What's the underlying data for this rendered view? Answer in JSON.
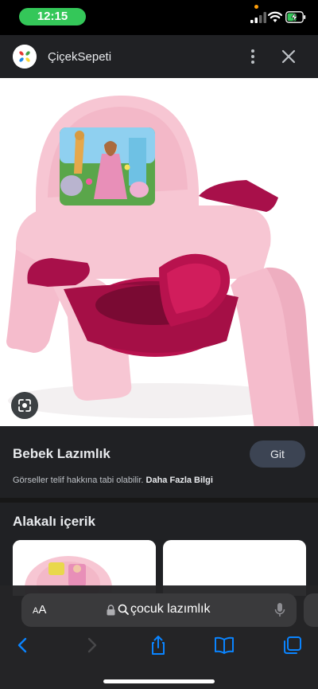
{
  "status_bar": {
    "time": "12:15",
    "time_pill_color": "#34c759",
    "icons": [
      "signal-icon",
      "wifi-icon",
      "battery-charging-icon"
    ]
  },
  "header": {
    "site_name": "ÇiçekSepeti",
    "icons": [
      "ciceksepeti-logo",
      "more-vert-icon",
      "close-icon"
    ]
  },
  "image": {
    "lens_icon": "google-lens-icon"
  },
  "product": {
    "title": "Bebek Lazımlık",
    "go_label": "Git",
    "copyright_text": "Görseller telif hakkına tabi olabilir.",
    "more_info_link": "Daha Fazla Bilgi"
  },
  "related": {
    "title": "Alakalı içerik"
  },
  "browser": {
    "text_size_label_small": "A",
    "text_size_label_large": "A",
    "url_text": "çocuk lazımlık",
    "toolbar_icons": [
      "back-icon",
      "forward-icon",
      "share-icon",
      "bookmarks-icon",
      "tabs-icon"
    ],
    "accent_color": "#0a84ff"
  }
}
